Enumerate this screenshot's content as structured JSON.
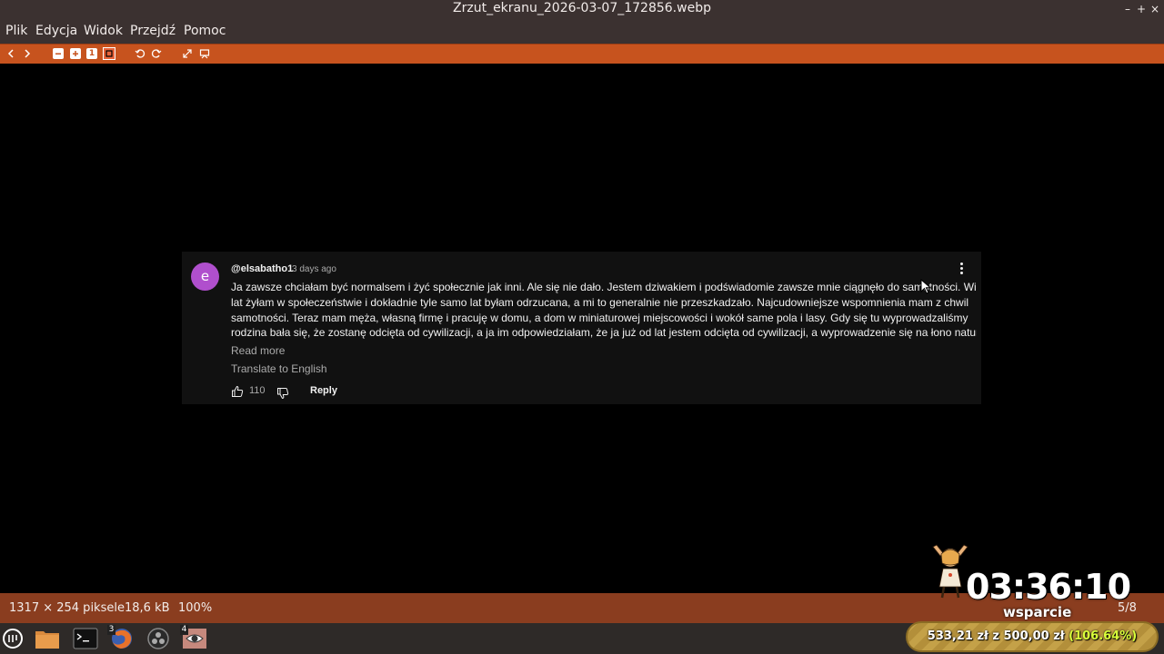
{
  "window": {
    "title": "Zrzut_ekranu_2026-03-07_172856.webp",
    "controls": {
      "minimize": "–",
      "maximize": "+",
      "close": "×"
    }
  },
  "menu": [
    "Plik",
    "Edycja",
    "Widok",
    "Przejdź",
    "Pomoc"
  ],
  "toolbar": {
    "icons": [
      "back-icon",
      "forward-icon",
      "zoom-out-icon",
      "zoom-in-icon",
      "zoom-original-icon",
      "zoom-fit-icon",
      "rotate-left-icon",
      "rotate-right-icon",
      "fullscreen-icon",
      "slideshow-icon"
    ],
    "zoom_original_label": "1"
  },
  "comment": {
    "avatar_letter": "e",
    "author": "@elsabatho1",
    "time_ago": "3 days ago",
    "lines": [
      "Ja zawsze chciałam być normalsem i żyć społecznie jak inni. Ale się nie dało. Jestem dziwakiem i podświadomie zawsze mnie ciągnęło do samotności. Wiele",
      "lat żyłam w społeczeństwie i dokładnie tyle samo lat byłam odrzucana, a mi to generalnie nie przeszkadzało. Najcudowniejsze wspomnienia mam z chwil",
      "samotności. Teraz mam męża, własną firmę i pracuję w domu, a dom w miniaturowej miejscowości i wokół same pola i lasy. Gdy się tu wyprowadzaliśmy",
      "rodzina bała się, że zostanę odcięta od cywilizacji, a ja im odpowiedziałam, że ja już od lat jestem odcięta od cywilizacji, a wyprowadzenie się na łono natury ..."
    ],
    "read_more": "Read more",
    "translate": "Translate to English",
    "likes": "110",
    "reply": "Reply"
  },
  "status": {
    "dimensions": "1317 × 254 piksele",
    "size": "18,6 kB",
    "zoom": "100%",
    "position": "5/8"
  },
  "overlay": {
    "timer": "03:36:10",
    "label": "wsparcie",
    "goal_amount": "533,21 zł",
    "goal_of": "z",
    "goal_target": "500,00 zł",
    "goal_percent": "(106.64%)"
  },
  "taskbar": {
    "apps": [
      "menu-icon",
      "files-icon",
      "terminal-icon",
      "firefox-icon",
      "obs-icon",
      "image-viewer-icon"
    ],
    "badges": {
      "firefox": "3",
      "image_viewer": "4"
    }
  },
  "colors": {
    "titlebar": "#3b3130",
    "toolbar": "#c7531e",
    "statusbar": "#8a3d1f",
    "avatar": "#b04fcd",
    "card": "#111111",
    "goal_percent": "#d9ff3a"
  }
}
